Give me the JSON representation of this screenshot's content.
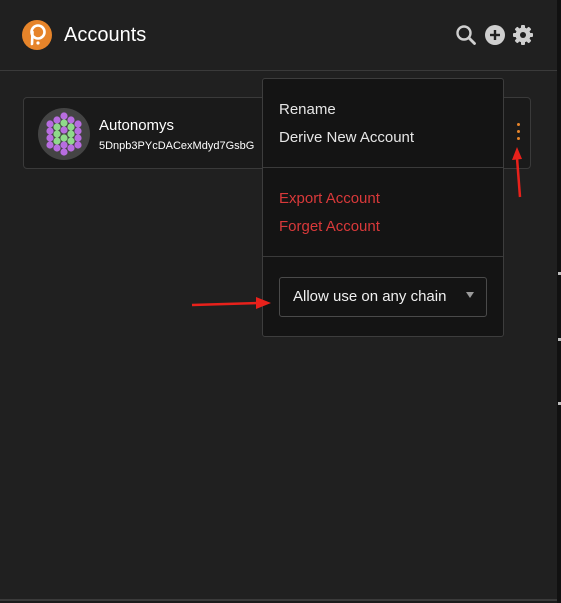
{
  "header": {
    "title": "Accounts",
    "logo_icon": "polkadot-logo-icon",
    "icons": [
      "search-icon",
      "add-circle-icon",
      "gear-icon"
    ]
  },
  "account": {
    "name": "Autonomys",
    "address": "5Dnpb3PYcDACexMdyd7GsbG",
    "avatar_icon": "identicon-avatar",
    "menu_icon": "kebab-menu-icon"
  },
  "menu": {
    "rename": "Rename",
    "derive": "Derive New Account",
    "export": "Export Account",
    "forget": "Forget Account",
    "chain_select": {
      "value": "Allow use on any chain"
    }
  },
  "colors": {
    "accent": "#e6842a",
    "danger": "#d9393a",
    "annotation": "#e8211b"
  }
}
